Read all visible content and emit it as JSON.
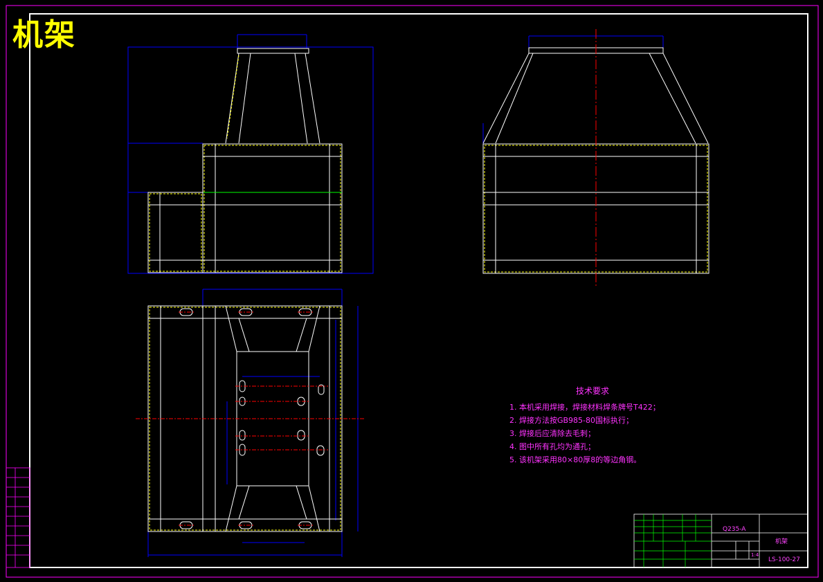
{
  "drawing": {
    "title": "机架",
    "tech_requirements": {
      "heading": "技术要求",
      "items": [
        "1. 本机采用焊接，焊接材料焊条牌号T422；",
        "2. 焊接方法按GB985-80国标执行；",
        "3. 焊接后应清除去毛刺；",
        "4. 图中所有孔均为通孔；",
        "5. 该机架采用80×80厚8的等边角钢。"
      ]
    },
    "title_block": {
      "material": "Q235-A",
      "part_name": "机架",
      "drawing_number": "LS-100-27",
      "scale": "1:4"
    },
    "colors": {
      "paper": "#000000",
      "border": "#ffffff",
      "outer_border": "#ff00ff",
      "geometry": "#ffffff",
      "dimension": "#0000ff",
      "centerline": "#ff0000",
      "hidden": "#ffff00",
      "text": "#ff33ff",
      "title": "#ffff00"
    }
  }
}
